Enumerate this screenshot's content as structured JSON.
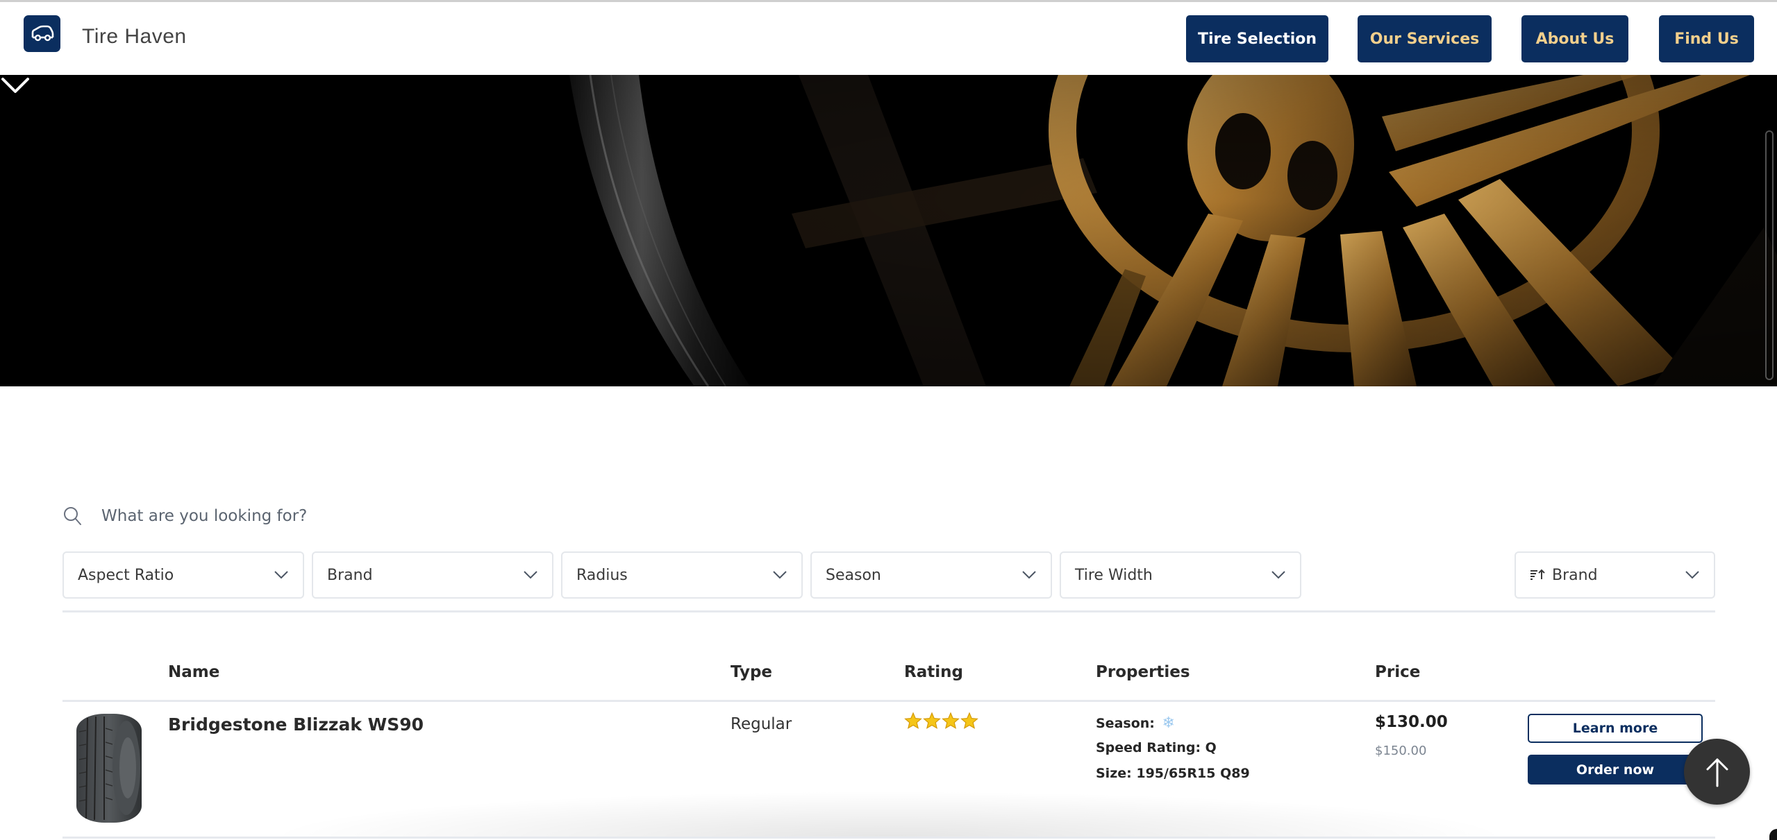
{
  "header": {
    "title": "Tire Haven",
    "logo_icon": "car-icon",
    "nav": [
      {
        "label": "Tire Selection",
        "active": true
      },
      {
        "label": "Our Services",
        "active": false
      },
      {
        "label": "About Us",
        "active": false
      },
      {
        "label": "Find Us",
        "active": false
      }
    ]
  },
  "hero": {
    "scroll_icon": "chevron-down-icon"
  },
  "search": {
    "placeholder": "What are you looking for?",
    "value": ""
  },
  "filters": [
    {
      "label": "Aspect Ratio"
    },
    {
      "label": "Brand"
    },
    {
      "label": "Radius"
    },
    {
      "label": "Season"
    },
    {
      "label": "Tire Width"
    }
  ],
  "sort": {
    "label": "Brand",
    "icon": "sort-ascending-icon"
  },
  "table": {
    "columns": [
      "Name",
      "Type",
      "Rating",
      "Properties",
      "Price"
    ],
    "rows": [
      {
        "name": "Bridgestone Blizzak WS90",
        "type": "Regular",
        "rating": 4,
        "season_label": "Season:",
        "season_icon": "snowflake-icon",
        "season_glyph": "❄",
        "speed_rating": "Speed Rating: Q",
        "size": "Size: 195/65R15 Q89",
        "price": "$130.00",
        "old_price": "$150.00",
        "learn_more": "Learn more",
        "order_now": "Order now"
      }
    ]
  },
  "colors": {
    "primary": "#0b2e5f",
    "nav_gold": "#f2cf8c",
    "back_to_top": "#333333"
  }
}
